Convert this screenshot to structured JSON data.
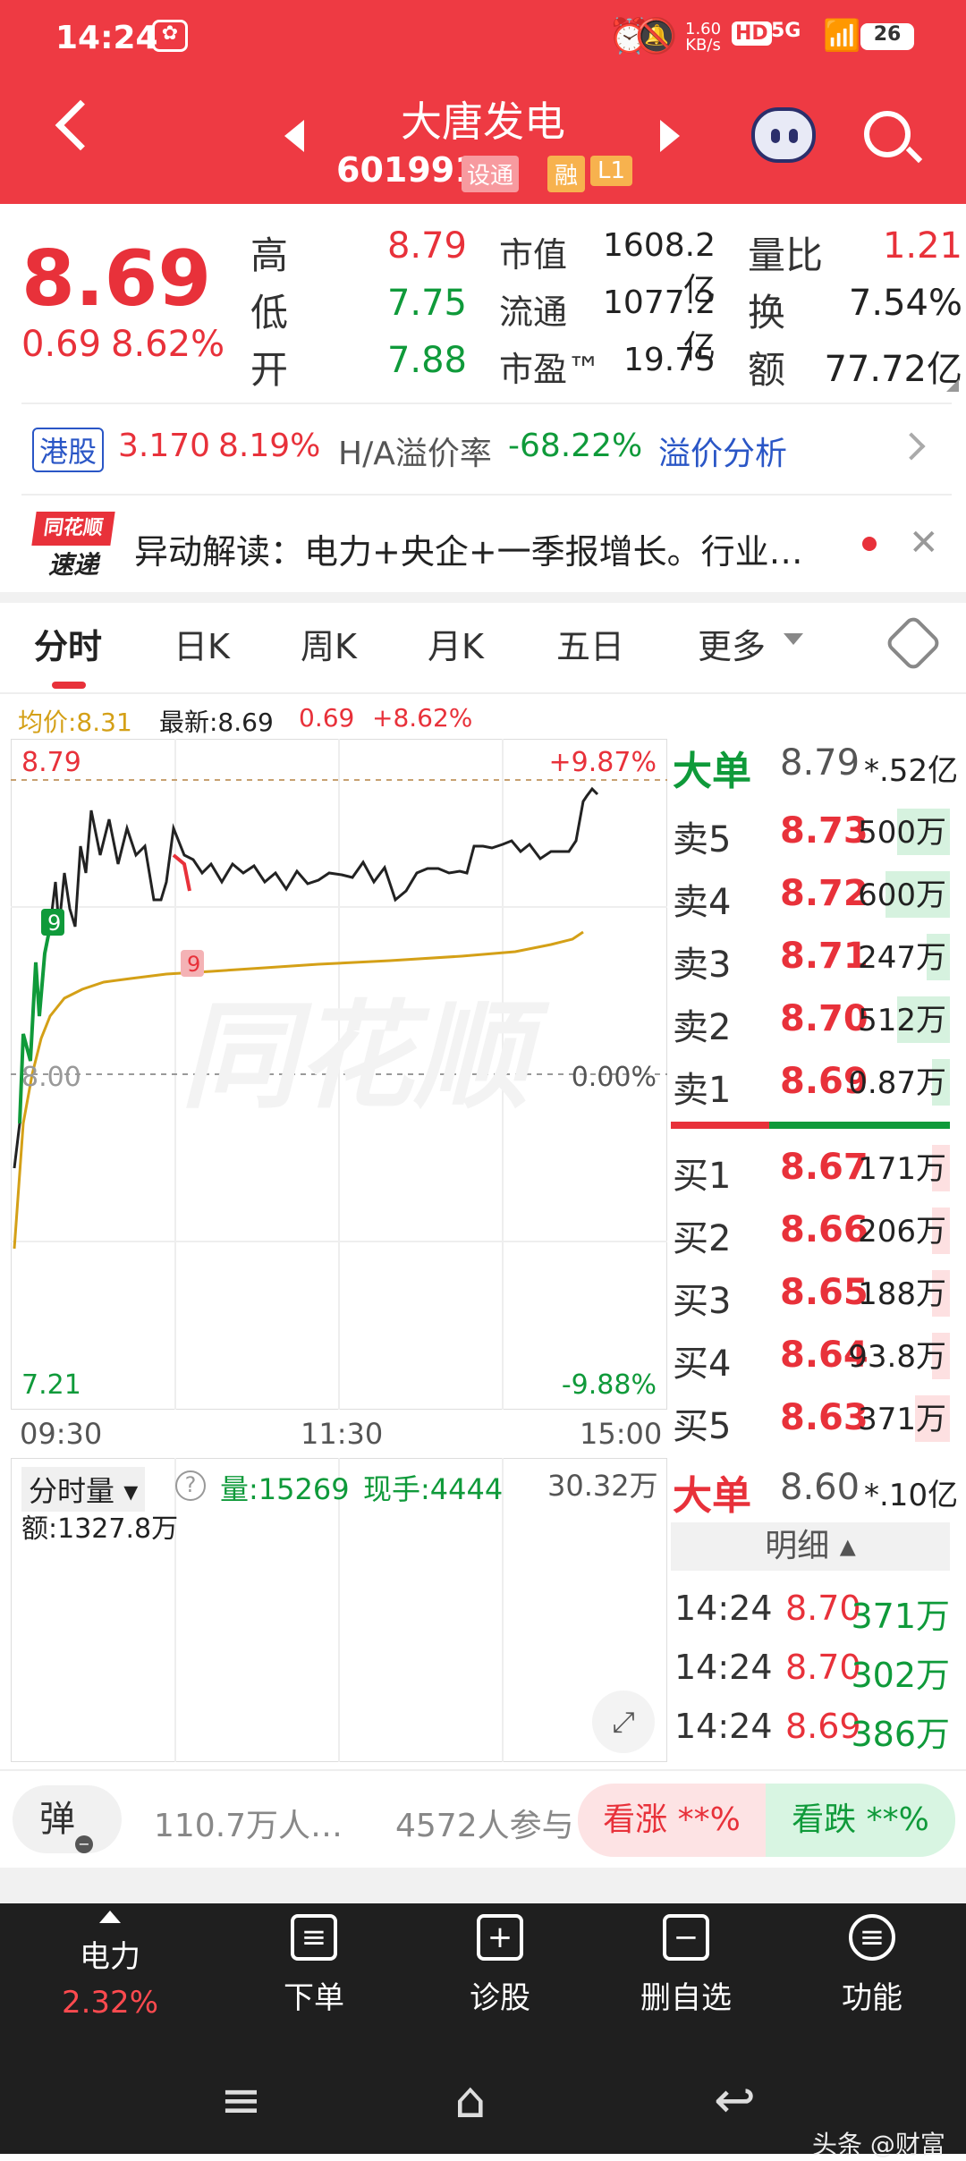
{
  "status": {
    "time": "14:24",
    "net_speed": "1.60",
    "net_unit": "KB/s",
    "hd": "HD",
    "signal": "5G",
    "battery": "26"
  },
  "header": {
    "title": "大唐发电",
    "code": "601991",
    "tag1": "设通",
    "tag2": "融",
    "tag3": "L1"
  },
  "quote": {
    "price": "8.69",
    "change": "0.69",
    "change_pct": "8.62%",
    "items": [
      {
        "label": "高",
        "value": "8.79",
        "color": "red"
      },
      {
        "label": "低",
        "value": "7.75",
        "color": "green"
      },
      {
        "label": "开",
        "value": "7.88",
        "color": "green"
      }
    ],
    "mid": [
      {
        "label": "市值",
        "value": "1608.2亿"
      },
      {
        "label": "流通",
        "value": "1077.2亿"
      },
      {
        "label": "市盈™",
        "value": "19.75"
      }
    ],
    "right": [
      {
        "label": "量比",
        "value": "1.21",
        "color": "red"
      },
      {
        "label": "换",
        "value": "7.54%",
        "color": "dark"
      },
      {
        "label": "额",
        "value": "77.72亿",
        "color": "dark"
      }
    ]
  },
  "hk": {
    "tag": "港股",
    "price": "3.170",
    "pct": "8.19%",
    "premium_label": "H/A溢价率",
    "premium": "-68.22%",
    "link": "溢价分析"
  },
  "news": {
    "logo_top": "同花顺",
    "logo_bottom": "速递",
    "text": "异动解读：电力+央企+一季报增长。行业…"
  },
  "tabs": [
    "分时",
    "日K",
    "周K",
    "月K",
    "五日",
    "更多"
  ],
  "chart": {
    "avg_label": "均价:8.31",
    "latest_label": "最新:8.69",
    "chg": "0.69",
    "chg_pct": "+8.62%",
    "y_high": "8.79",
    "y_mid": "8.00",
    "y_low": "7.21",
    "pct_high": "+9.87%",
    "pct_mid": "0.00%",
    "pct_low": "-9.88%",
    "x_start": "09:30",
    "x_mid": "11:30",
    "x_end": "15:00",
    "marker1": "9",
    "marker2": "9",
    "watermark": "同花顺"
  },
  "volume": {
    "selector": "分时量",
    "vol": "量:15269",
    "hand": "现手:4444",
    "max": "30.32万",
    "amount": "额:1327.8万"
  },
  "orderbook": {
    "big_top_label": "大单",
    "big_top_price": "8.79",
    "big_top_val": "*.52亿",
    "asks": [
      {
        "l": "卖5",
        "p": "8.73",
        "v": "500万",
        "f": 0.45
      },
      {
        "l": "卖4",
        "p": "8.72",
        "v": "600万",
        "f": 0.55
      },
      {
        "l": "卖3",
        "p": "8.71",
        "v": "247万",
        "f": 0.2
      },
      {
        "l": "卖2",
        "p": "8.70",
        "v": "512万",
        "f": 0.45
      },
      {
        "l": "卖1",
        "p": "8.69",
        "v": "0.87万",
        "f": 0.02
      }
    ],
    "bids": [
      {
        "l": "买1",
        "p": "8.67",
        "v": "171万",
        "f": 0.12
      },
      {
        "l": "买2",
        "p": "8.66",
        "v": "206万",
        "f": 0.15
      },
      {
        "l": "买3",
        "p": "8.65",
        "v": "188万",
        "f": 0.13
      },
      {
        "l": "买4",
        "p": "8.64",
        "v": "93.8万",
        "f": 0.07
      },
      {
        "l": "买5",
        "p": "8.63",
        "v": "371万",
        "f": 0.3
      }
    ],
    "big_bot_label": "大单",
    "big_bot_price": "8.60",
    "big_bot_val": "*.10亿",
    "detail_label": "明细",
    "details": [
      {
        "t": "14:24",
        "p": "8.70",
        "v": "371万"
      },
      {
        "t": "14:24",
        "p": "8.70",
        "v": "302万"
      },
      {
        "t": "14:24",
        "p": "8.69",
        "v": "386万"
      }
    ]
  },
  "social": {
    "bullet": "弹",
    "count": "110.7万人…",
    "join": "4572人参与",
    "up": "看涨 **%",
    "down": "看跌 **%"
  },
  "nav": [
    {
      "label": "电力",
      "sub": "2.32%"
    },
    {
      "label": "下单"
    },
    {
      "label": "诊股"
    },
    {
      "label": "删自选"
    },
    {
      "label": "功能"
    }
  ],
  "footer": {
    "brand": "头条 @财富"
  },
  "colors": {
    "brand_red": "#ee3a43",
    "up": "#e8313a",
    "down": "#0f9a3a",
    "avg_line": "#d4a017"
  }
}
